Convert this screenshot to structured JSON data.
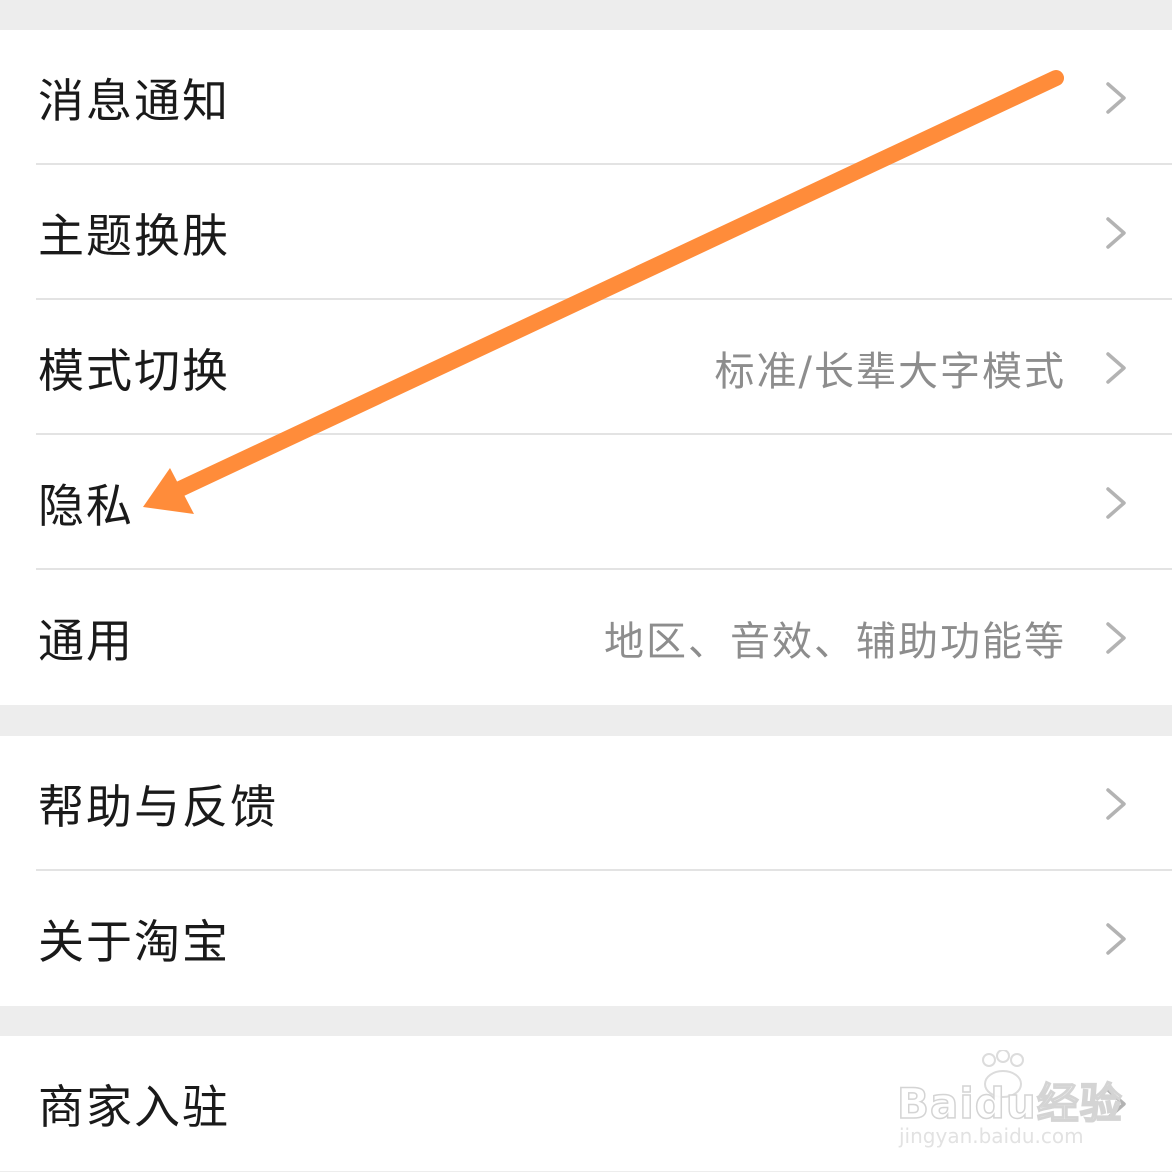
{
  "groups": [
    {
      "rows": [
        {
          "label": "消息通知",
          "value": ""
        },
        {
          "label": "主题换肤",
          "value": ""
        },
        {
          "label": "模式切换",
          "value": "标准/长辈大字模式"
        },
        {
          "label": "隐私",
          "value": ""
        },
        {
          "label": "通用",
          "value": "地区、音效、辅助功能等"
        }
      ]
    },
    {
      "rows": [
        {
          "label": "帮助与反馈",
          "value": ""
        },
        {
          "label": "关于淘宝",
          "value": ""
        }
      ]
    },
    {
      "rows": [
        {
          "label": "商家入驻",
          "value": ""
        }
      ]
    }
  ],
  "annotation": {
    "color": "#ff8c3a",
    "points_to": "隐私"
  },
  "watermark": {
    "brand": "Baidu经验",
    "url": "jingyan.baidu.com"
  },
  "icons": {
    "row_chevron": "chevron-right-icon",
    "annotation_arrow": "arrow-icon"
  },
  "colors": {
    "background": "#ededed",
    "card": "#ffffff",
    "label": "#1a1a1a",
    "value": "#8d8d8d",
    "chevron": "#b3b3b3"
  }
}
